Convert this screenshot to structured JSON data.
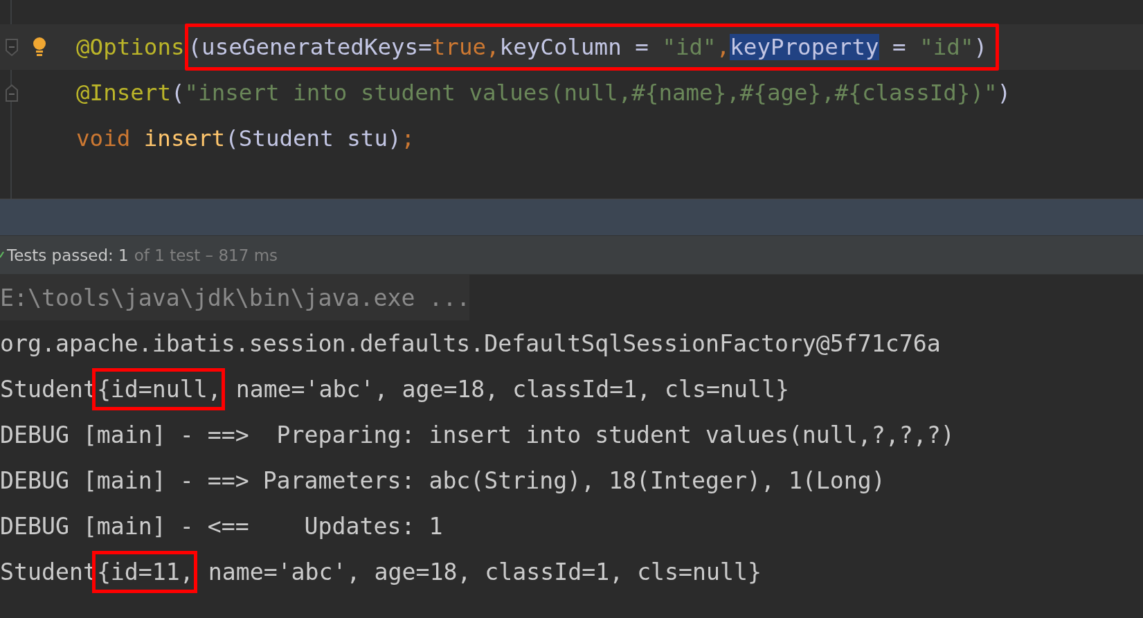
{
  "editor": {
    "lines": [
      {
        "current": true,
        "bulb": true,
        "fold_start": true,
        "fold_end": false,
        "segments": [
          {
            "boxed": false,
            "tokens": [
              {
                "text": "@Options",
                "kind": "annotation",
                "selected": false
              }
            ]
          },
          {
            "boxed": true,
            "tokens": [
              {
                "text": "(useGeneratedKeys=",
                "kind": "plain",
                "selected": false
              },
              {
                "text": "true",
                "kind": "keyword",
                "selected": false
              },
              {
                "text": ",",
                "kind": "keyword",
                "selected": false
              },
              {
                "text": "keyColumn = ",
                "kind": "plain",
                "selected": false
              },
              {
                "text": "\"id\"",
                "kind": "string",
                "selected": false
              },
              {
                "text": ",",
                "kind": "keyword",
                "selected": false
              },
              {
                "text": "keyProperty",
                "kind": "plain",
                "selected": true
              },
              {
                "text": " = ",
                "kind": "plain",
                "selected": false
              },
              {
                "text": "\"id\"",
                "kind": "string",
                "selected": false
              },
              {
                "text": ")",
                "kind": "plain",
                "selected": false
              }
            ]
          }
        ]
      },
      {
        "current": false,
        "bulb": false,
        "fold_start": false,
        "fold_end": true,
        "segments": [
          {
            "boxed": false,
            "tokens": [
              {
                "text": "@Insert",
                "kind": "annotation",
                "selected": false
              },
              {
                "text": "(",
                "kind": "plain",
                "selected": false
              },
              {
                "text": "\"insert into student values(null,#{name},#{age},#{classId})\"",
                "kind": "string",
                "selected": false
              },
              {
                "text": ")",
                "kind": "plain",
                "selected": false
              }
            ]
          }
        ]
      },
      {
        "current": false,
        "bulb": false,
        "fold_start": false,
        "fold_end": false,
        "segments": [
          {
            "boxed": false,
            "tokens": [
              {
                "text": "void",
                "kind": "keyword",
                "selected": false
              },
              {
                "text": "insert",
                "kind": "method",
                "selected": false
              },
              {
                "text": "(Student stu)",
                "kind": "plain",
                "selected": false
              },
              {
                "text": ";",
                "kind": "keyword",
                "selected": false
              }
            ]
          }
        ]
      }
    ]
  },
  "test_status": {
    "passed_label": "Tests passed: 1",
    "detail": "of 1 test – 817 ms"
  },
  "console": {
    "lines": [
      {
        "kind": "command",
        "segments": [
          {
            "boxed": false,
            "text": "E:\\tools\\java\\jdk\\bin\\java.exe ..."
          }
        ]
      },
      {
        "kind": "output",
        "segments": [
          {
            "boxed": false,
            "text": "org.apache.ibatis.session.defaults.DefaultSqlSessionFactory@5f71c76a"
          }
        ]
      },
      {
        "kind": "output",
        "segments": [
          {
            "boxed": false,
            "text": "Student"
          },
          {
            "boxed": true,
            "text": "{id=null,"
          },
          {
            "boxed": false,
            "text": " name='abc', age=18, classId=1, cls=null}"
          }
        ]
      },
      {
        "kind": "output",
        "segments": [
          {
            "boxed": false,
            "text": "DEBUG [main] - ==>  Preparing: insert into student values(null,?,?,?)"
          }
        ]
      },
      {
        "kind": "output",
        "segments": [
          {
            "boxed": false,
            "text": "DEBUG [main] - ==> Parameters: abc(String), 18(Integer), 1(Long)"
          }
        ]
      },
      {
        "kind": "output",
        "segments": [
          {
            "boxed": false,
            "text": "DEBUG [main] - <==    Updates: 1"
          }
        ]
      },
      {
        "kind": "output",
        "segments": [
          {
            "boxed": false,
            "text": "Student"
          },
          {
            "boxed": true,
            "text": "{id=11,"
          },
          {
            "boxed": false,
            "text": " name='abc', age=18, classId=1, cls=null}"
          }
        ]
      }
    ]
  }
}
